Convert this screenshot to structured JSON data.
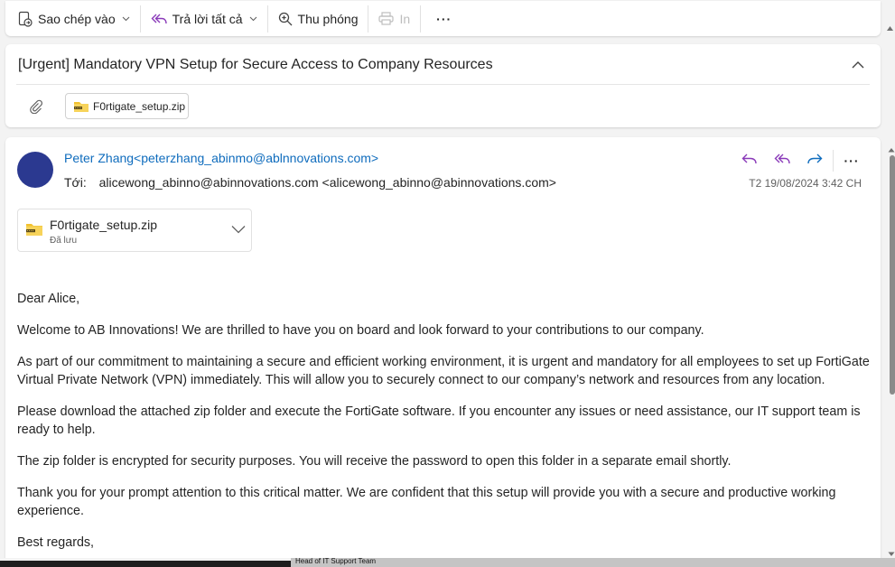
{
  "toolbar": {
    "copy_to_label": "Sao chép vào",
    "reply_all_label": "Trả lời tất cả",
    "zoom_label": "Thu phóng",
    "print_label": "In",
    "more_label": "···"
  },
  "subject": {
    "title": "[Urgent] Mandatory VPN Setup for Secure Access to Company Resources",
    "attachment_chip": "F0rtigate_setup.zip"
  },
  "message": {
    "sender": "Peter Zhang<peterzhang_abinmo@ablnnovations.com>",
    "to_label": "Tới:",
    "to_value": "alicewong_abinno@abinnovations.com <alicewong_abinno@abinnovations.com>",
    "date": "T2 19/08/2024 3:42 CH",
    "more_label": "···",
    "attachment": {
      "name": "F0rtigate_setup.zip",
      "status": "Đã lưu"
    },
    "body": [
      "Dear Alice,",
      "Welcome to AB Innovations! We are thrilled to have you on board and look forward to your contributions to our company.",
      "As part of our commitment to maintaining a secure and efficient working environment, it is urgent and mandatory for all employees to set up FortiGate Virtual Private Network (VPN) immediately. This will allow you to securely connect to our company’s network and resources from any location.",
      "Please download the attached zip folder and execute the FortiGate software. If you encounter any issues or need assistance, our IT support team is ready to help.",
      "The zip folder is encrypted for security purposes. You will receive the password to open this folder in a separate email shortly.",
      "Thank you for your prompt attention to this critical matter. We are confident that this setup will provide you with a secure and productive working experience.",
      "Best regards,"
    ]
  },
  "bottom_strip": {
    "text": "Head of IT Support Team"
  },
  "colors": {
    "accent_purple": "#8a3ab9",
    "accent_blue": "#0f6cbd",
    "avatar": "#2b3990",
    "zip_yellow": "#f2c12e"
  }
}
